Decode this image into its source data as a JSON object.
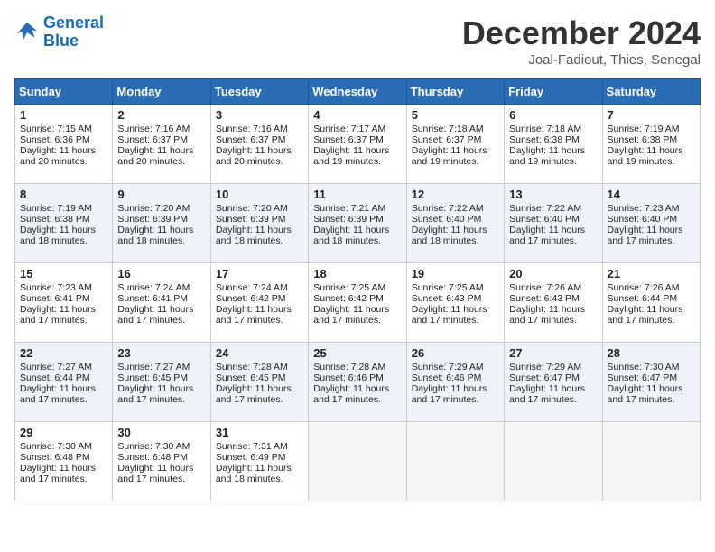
{
  "logo": {
    "line1": "General",
    "line2": "Blue"
  },
  "title": "December 2024",
  "subtitle": "Joal-Fadiout, Thies, Senegal",
  "days_header": [
    "Sunday",
    "Monday",
    "Tuesday",
    "Wednesday",
    "Thursday",
    "Friday",
    "Saturday"
  ],
  "weeks": [
    [
      {
        "day": "1",
        "info": "Sunrise: 7:15 AM\nSunset: 6:36 PM\nDaylight: 11 hours\nand 20 minutes."
      },
      {
        "day": "2",
        "info": "Sunrise: 7:16 AM\nSunset: 6:37 PM\nDaylight: 11 hours\nand 20 minutes."
      },
      {
        "day": "3",
        "info": "Sunrise: 7:16 AM\nSunset: 6:37 PM\nDaylight: 11 hours\nand 20 minutes."
      },
      {
        "day": "4",
        "info": "Sunrise: 7:17 AM\nSunset: 6:37 PM\nDaylight: 11 hours\nand 19 minutes."
      },
      {
        "day": "5",
        "info": "Sunrise: 7:18 AM\nSunset: 6:37 PM\nDaylight: 11 hours\nand 19 minutes."
      },
      {
        "day": "6",
        "info": "Sunrise: 7:18 AM\nSunset: 6:38 PM\nDaylight: 11 hours\nand 19 minutes."
      },
      {
        "day": "7",
        "info": "Sunrise: 7:19 AM\nSunset: 6:38 PM\nDaylight: 11 hours\nand 19 minutes."
      }
    ],
    [
      {
        "day": "8",
        "info": "Sunrise: 7:19 AM\nSunset: 6:38 PM\nDaylight: 11 hours\nand 18 minutes."
      },
      {
        "day": "9",
        "info": "Sunrise: 7:20 AM\nSunset: 6:39 PM\nDaylight: 11 hours\nand 18 minutes."
      },
      {
        "day": "10",
        "info": "Sunrise: 7:20 AM\nSunset: 6:39 PM\nDaylight: 11 hours\nand 18 minutes."
      },
      {
        "day": "11",
        "info": "Sunrise: 7:21 AM\nSunset: 6:39 PM\nDaylight: 11 hours\nand 18 minutes."
      },
      {
        "day": "12",
        "info": "Sunrise: 7:22 AM\nSunset: 6:40 PM\nDaylight: 11 hours\nand 18 minutes."
      },
      {
        "day": "13",
        "info": "Sunrise: 7:22 AM\nSunset: 6:40 PM\nDaylight: 11 hours\nand 17 minutes."
      },
      {
        "day": "14",
        "info": "Sunrise: 7:23 AM\nSunset: 6:40 PM\nDaylight: 11 hours\nand 17 minutes."
      }
    ],
    [
      {
        "day": "15",
        "info": "Sunrise: 7:23 AM\nSunset: 6:41 PM\nDaylight: 11 hours\nand 17 minutes."
      },
      {
        "day": "16",
        "info": "Sunrise: 7:24 AM\nSunset: 6:41 PM\nDaylight: 11 hours\nand 17 minutes."
      },
      {
        "day": "17",
        "info": "Sunrise: 7:24 AM\nSunset: 6:42 PM\nDaylight: 11 hours\nand 17 minutes."
      },
      {
        "day": "18",
        "info": "Sunrise: 7:25 AM\nSunset: 6:42 PM\nDaylight: 11 hours\nand 17 minutes."
      },
      {
        "day": "19",
        "info": "Sunrise: 7:25 AM\nSunset: 6:43 PM\nDaylight: 11 hours\nand 17 minutes."
      },
      {
        "day": "20",
        "info": "Sunrise: 7:26 AM\nSunset: 6:43 PM\nDaylight: 11 hours\nand 17 minutes."
      },
      {
        "day": "21",
        "info": "Sunrise: 7:26 AM\nSunset: 6:44 PM\nDaylight: 11 hours\nand 17 minutes."
      }
    ],
    [
      {
        "day": "22",
        "info": "Sunrise: 7:27 AM\nSunset: 6:44 PM\nDaylight: 11 hours\nand 17 minutes."
      },
      {
        "day": "23",
        "info": "Sunrise: 7:27 AM\nSunset: 6:45 PM\nDaylight: 11 hours\nand 17 minutes."
      },
      {
        "day": "24",
        "info": "Sunrise: 7:28 AM\nSunset: 6:45 PM\nDaylight: 11 hours\nand 17 minutes."
      },
      {
        "day": "25",
        "info": "Sunrise: 7:28 AM\nSunset: 6:46 PM\nDaylight: 11 hours\nand 17 minutes."
      },
      {
        "day": "26",
        "info": "Sunrise: 7:29 AM\nSunset: 6:46 PM\nDaylight: 11 hours\nand 17 minutes."
      },
      {
        "day": "27",
        "info": "Sunrise: 7:29 AM\nSunset: 6:47 PM\nDaylight: 11 hours\nand 17 minutes."
      },
      {
        "day": "28",
        "info": "Sunrise: 7:30 AM\nSunset: 6:47 PM\nDaylight: 11 hours\nand 17 minutes."
      }
    ],
    [
      {
        "day": "29",
        "info": "Sunrise: 7:30 AM\nSunset: 6:48 PM\nDaylight: 11 hours\nand 17 minutes."
      },
      {
        "day": "30",
        "info": "Sunrise: 7:30 AM\nSunset: 6:48 PM\nDaylight: 11 hours\nand 17 minutes."
      },
      {
        "day": "31",
        "info": "Sunrise: 7:31 AM\nSunset: 6:49 PM\nDaylight: 11 hours\nand 18 minutes."
      },
      {
        "day": "",
        "info": ""
      },
      {
        "day": "",
        "info": ""
      },
      {
        "day": "",
        "info": ""
      },
      {
        "day": "",
        "info": ""
      }
    ]
  ]
}
